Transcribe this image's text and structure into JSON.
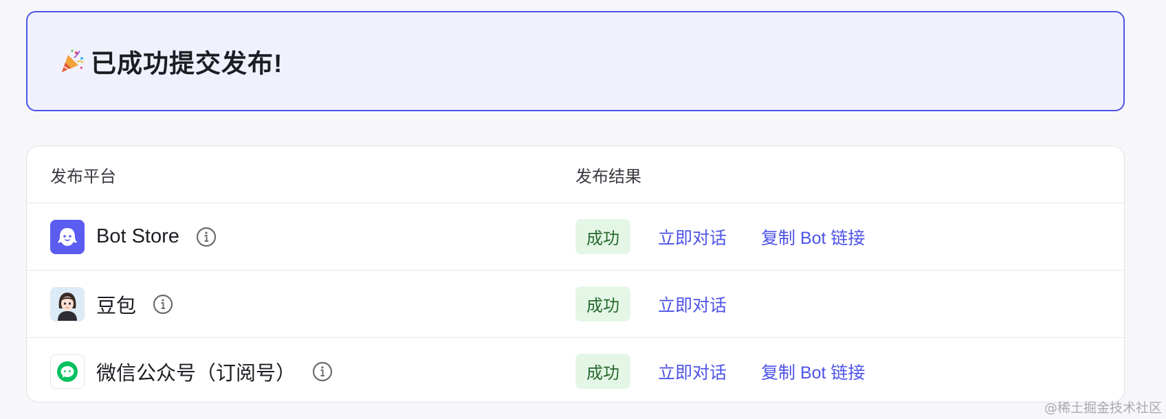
{
  "banner": {
    "emoji_icon": "party-popper-icon",
    "title": "已成功提交发布!"
  },
  "table": {
    "headers": {
      "platform": "发布平台",
      "result": "发布结果"
    },
    "rows": [
      {
        "icon": "bot-store-icon",
        "name": "Bot Store",
        "status": "成功",
        "chat_link": "立即对话",
        "copy_link": "复制 Bot 链接"
      },
      {
        "icon": "doubao-avatar-icon",
        "name": "豆包",
        "status": "成功",
        "chat_link": "立即对话"
      },
      {
        "icon": "wechat-icon",
        "name": "微信公众号（订阅号）",
        "status": "成功",
        "chat_link": "立即对话",
        "copy_link": "复制 Bot 链接"
      }
    ]
  },
  "watermark": "@稀土掘金技术社区",
  "colors": {
    "accent": "#4d53e8",
    "success_bg": "#e4f6e6",
    "success_text": "#27692d",
    "wechat_green": "#07c160"
  }
}
